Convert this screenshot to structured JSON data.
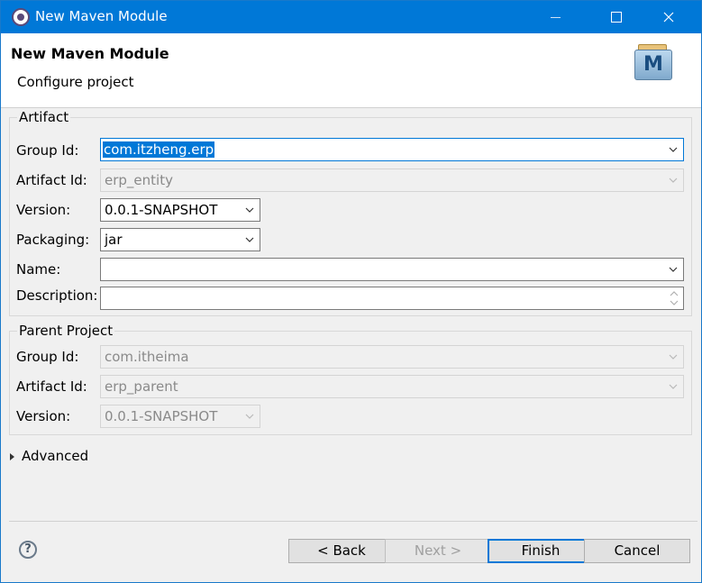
{
  "window": {
    "title": "New Maven Module",
    "controls": [
      "minimize",
      "maximize",
      "close"
    ]
  },
  "banner": {
    "heading": "New Maven Module",
    "description": "Configure project",
    "logo_letter": "M"
  },
  "artifact": {
    "legend": "Artifact",
    "group_id": {
      "label": "Group Id:",
      "value": "com.itzheng.erp"
    },
    "artifact_id": {
      "label": "Artifact Id:",
      "value": "erp_entity"
    },
    "version": {
      "label": "Version:",
      "value": "0.0.1-SNAPSHOT"
    },
    "packaging": {
      "label": "Packaging:",
      "value": "jar"
    },
    "name": {
      "label": "Name:",
      "value": ""
    },
    "description": {
      "label": "Description:",
      "value": ""
    }
  },
  "parent": {
    "legend": "Parent Project",
    "group_id": {
      "label": "Group Id:",
      "value": "com.itheima"
    },
    "artifact_id": {
      "label": "Artifact Id:",
      "value": "erp_parent"
    },
    "version": {
      "label": "Version:",
      "value": "0.0.1-SNAPSHOT"
    }
  },
  "advanced": {
    "label": "Advanced"
  },
  "buttons": {
    "help": "?",
    "back": "< Back",
    "next": "Next >",
    "finish": "Finish",
    "cancel": "Cancel"
  },
  "colors": {
    "titlebar": "#0078d7",
    "selection": "#0078d7",
    "default_button_border": "#0078d7"
  }
}
